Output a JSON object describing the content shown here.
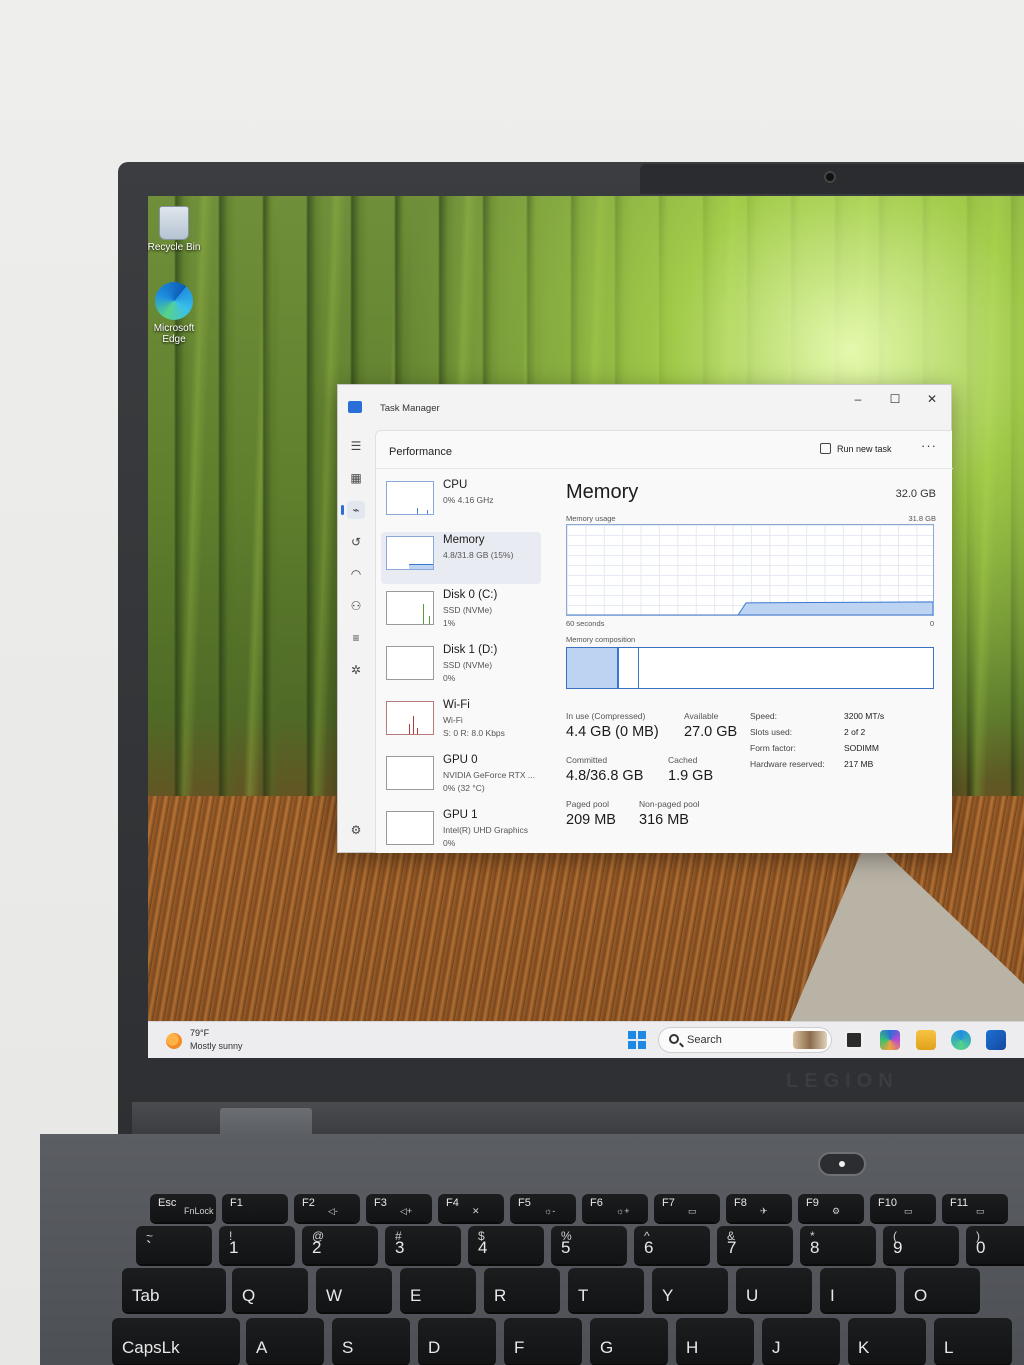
{
  "desktop": {
    "icons": [
      {
        "label": "Recycle Bin",
        "icon": "recycle-bin-icon"
      },
      {
        "label": "Microsoft Edge",
        "icon": "edge-icon"
      }
    ]
  },
  "task_manager": {
    "title": "Task Manager",
    "window_controls": {
      "minimize": "–",
      "maximize": "☐",
      "close": "✕"
    },
    "section": "Performance",
    "run_new_task": "Run new task",
    "more": "···",
    "rail_icons": [
      "hamburger-menu-icon",
      "processes-icon",
      "performance-icon",
      "app-history-icon",
      "startup-apps-icon",
      "users-icon",
      "details-icon",
      "services-icon",
      "settings-icon"
    ],
    "sidebar": [
      {
        "name": "CPU",
        "sub1": "0% 4.16 GHz",
        "sub2": ""
      },
      {
        "name": "Memory",
        "sub1": "4.8/31.8 GB (15%)",
        "sub2": ""
      },
      {
        "name": "Disk 0 (C:)",
        "sub1": "SSD (NVMe)",
        "sub2": "1%"
      },
      {
        "name": "Disk 1 (D:)",
        "sub1": "SSD (NVMe)",
        "sub2": "0%"
      },
      {
        "name": "Wi-Fi",
        "sub1": "Wi-Fi",
        "sub2": "S: 0 R: 8.0 Kbps"
      },
      {
        "name": "GPU 0",
        "sub1": "NVIDIA GeForce RTX ...",
        "sub2": "0% (32 °C)"
      },
      {
        "name": "GPU 1",
        "sub1": "Intel(R) UHD Graphics",
        "sub2": "0%"
      }
    ],
    "memory": {
      "title": "Memory",
      "total": "32.0 GB",
      "usage_label": "Memory usage",
      "usage_max": "31.8 GB",
      "time_label": "60 seconds",
      "time_min": "0",
      "usage_fraction": 0.15,
      "composition_label": "Memory composition",
      "stats": {
        "in_use_label": "In use (Compressed)",
        "in_use": "4.4 GB (0 MB)",
        "available_label": "Available",
        "available": "27.0 GB",
        "committed_label": "Committed",
        "committed": "4.8/36.8 GB",
        "cached_label": "Cached",
        "cached": "1.9 GB",
        "paged_pool_label": "Paged pool",
        "paged_pool": "209 MB",
        "non_paged_pool_label": "Non-paged pool",
        "non_paged_pool": "316 MB"
      },
      "specs": [
        {
          "key": "Speed:",
          "value": "3200 MT/s"
        },
        {
          "key": "Slots used:",
          "value": "2 of 2"
        },
        {
          "key": "Form factor:",
          "value": "SODIMM"
        },
        {
          "key": "Hardware reserved:",
          "value": "217 MB"
        }
      ],
      "accent": "#3b78d1"
    }
  },
  "taskbar": {
    "weather_temp": "79°F",
    "weather_desc": "Mostly sunny",
    "search_placeholder": "Search",
    "apps": [
      "task-view-icon",
      "copilot-icon",
      "file-explorer-icon",
      "edge-icon",
      "store-icon"
    ]
  },
  "keyboard": {
    "brand": "LEGION",
    "fn_row": [
      {
        "main": "Esc",
        "sub": "FnLock"
      },
      {
        "main": "F1",
        "sub": ""
      },
      {
        "main": "F2",
        "sub": "◁-"
      },
      {
        "main": "F3",
        "sub": "◁+"
      },
      {
        "main": "F4",
        "sub": "✕"
      },
      {
        "main": "F5",
        "sub": "☼-"
      },
      {
        "main": "F6",
        "sub": "☼+"
      },
      {
        "main": "F7",
        "sub": "▭"
      },
      {
        "main": "F8",
        "sub": "✈"
      },
      {
        "main": "F9",
        "sub": "⚙"
      },
      {
        "main": "F10",
        "sub": "▭"
      },
      {
        "main": "F11",
        "sub": "▭"
      }
    ],
    "num_row": [
      {
        "main": "`",
        "top": "~"
      },
      {
        "main": "1",
        "top": "!"
      },
      {
        "main": "2",
        "top": "@"
      },
      {
        "main": "3",
        "top": "#"
      },
      {
        "main": "4",
        "top": "$"
      },
      {
        "main": "5",
        "top": "%"
      },
      {
        "main": "6",
        "top": "^"
      },
      {
        "main": "7",
        "top": "&"
      },
      {
        "main": "8",
        "top": "*"
      },
      {
        "main": "9",
        "top": "("
      },
      {
        "main": "0",
        "top": ")"
      }
    ],
    "q_row": [
      "Tab",
      "Q",
      "W",
      "E",
      "R",
      "T",
      "Y",
      "U",
      "I",
      "O"
    ],
    "a_row": [
      "CapsLk",
      "A",
      "S",
      "D",
      "F",
      "G",
      "H",
      "J",
      "K",
      "L"
    ]
  }
}
